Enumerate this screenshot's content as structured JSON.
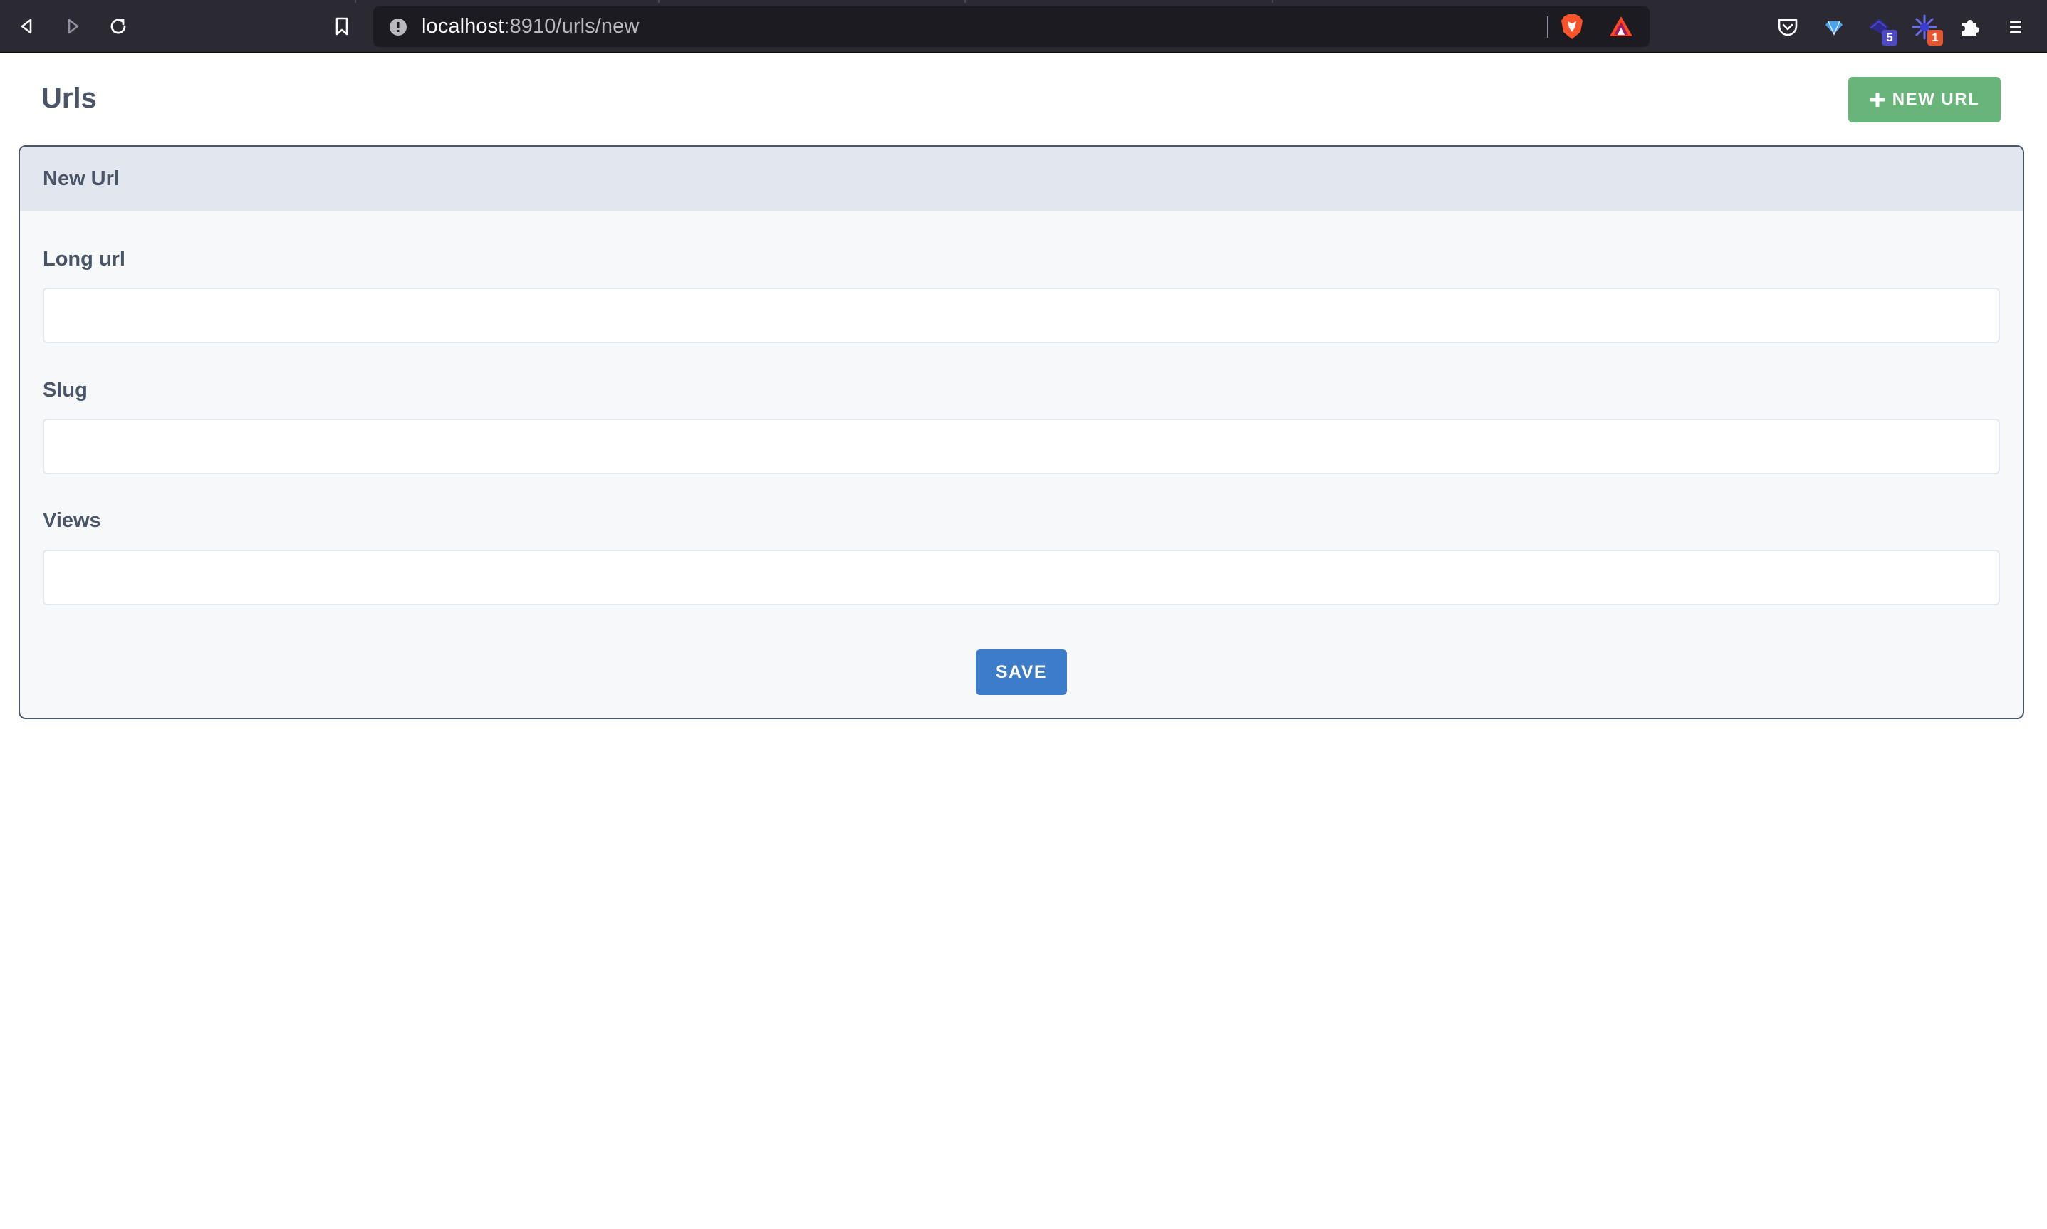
{
  "browser": {
    "url_host": "localhost",
    "url_path": ":8910/urls/new",
    "extension_badges": [
      "5",
      "1"
    ]
  },
  "page": {
    "title": "Urls",
    "new_button_label": "NEW URL"
  },
  "form": {
    "header": "New Url",
    "fields": [
      {
        "label": "Long url",
        "value": ""
      },
      {
        "label": "Slug",
        "value": ""
      },
      {
        "label": "Views",
        "value": ""
      }
    ],
    "save_label": "SAVE"
  },
  "colors": {
    "browser_bar": "#2b2a33",
    "new_button": "#68b47a",
    "save_button": "#3d7cc9",
    "card_header": "#e2e7ef",
    "text": "#4a5568"
  }
}
